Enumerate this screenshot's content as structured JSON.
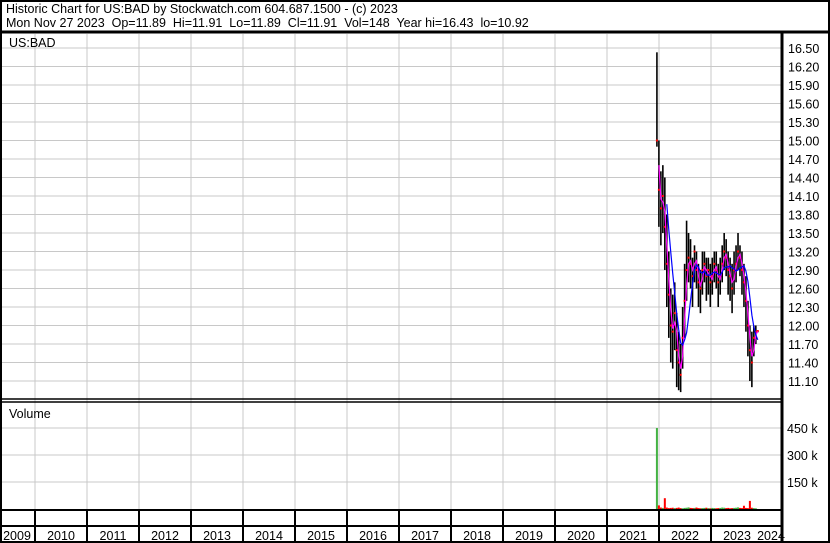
{
  "header": {
    "title_line": "Historic Chart for US:BAD by Stockwatch.com 604.687.1500 - (c) 2023",
    "quote_line": "Mon Nov 27 2023  Op=11.89  Hi=11.91  Lo=11.89  Cl=11.91  Vol=148  Year hi=16.43  lo=10.92"
  },
  "chart_data": {
    "type": "line",
    "title": "US:BAD",
    "volume_title": "Volume",
    "y_ticks": [
      "16.50",
      "16.20",
      "15.90",
      "15.60",
      "15.30",
      "15.00",
      "14.70",
      "14.40",
      "14.10",
      "13.80",
      "13.50",
      "13.20",
      "12.90",
      "12.60",
      "12.30",
      "12.00",
      "11.70",
      "11.40",
      "11.10"
    ],
    "ylim": [
      10.92,
      16.56
    ],
    "volume_ticks": [
      "450 k",
      "300 k",
      "150 k"
    ],
    "volume_ylim": [
      0,
      560
    ],
    "x_labels": [
      "2009",
      "2010",
      "2011",
      "2012",
      "2013",
      "2014",
      "2015",
      "2016",
      "2017",
      "2018",
      "2019",
      "2020",
      "2021",
      "2022",
      "2023",
      "2024"
    ],
    "xlim": [
      2009,
      2024.3
    ],
    "start": 2021.96,
    "end": 2023.9,
    "close": [
      15.0,
      14.2,
      13.9,
      14.1,
      13.6,
      13.0,
      12.5,
      12.0,
      11.9,
      12.2,
      11.6,
      11.4,
      11.2,
      11.8,
      12.4,
      12.9,
      13.1,
      13.0,
      12.8,
      13.2,
      12.9,
      12.7,
      12.6,
      12.9,
      13.0,
      12.8,
      12.9,
      12.7,
      12.8,
      13.0,
      12.9,
      12.7,
      12.8,
      13.0,
      13.2,
      13.1,
      12.9,
      12.8,
      12.6,
      12.9,
      13.0,
      13.2,
      13.1,
      12.9,
      12.7,
      12.4,
      12.0,
      11.6,
      11.4,
      11.8,
      11.9,
      11.91
    ],
    "high": [
      16.43,
      15.0,
      14.5,
      14.6,
      14.4,
      13.8,
      13.2,
      12.6,
      12.5,
      12.7,
      12.2,
      11.9,
      11.7,
      12.3,
      13.0,
      13.7,
      13.5,
      13.4,
      13.1,
      13.3,
      13.2,
      13.0,
      12.9,
      13.2,
      13.2,
      13.1,
      13.1,
      13.0,
      13.1,
      13.2,
      13.2,
      13.0,
      13.1,
      13.3,
      13.5,
      13.4,
      13.2,
      13.1,
      13.0,
      13.2,
      13.3,
      13.5,
      13.3,
      13.2,
      13.0,
      12.8,
      12.4,
      12.0,
      11.9,
      12.0,
      12.0,
      11.91
    ],
    "low": [
      14.9,
      13.6,
      13.3,
      13.5,
      12.9,
      12.3,
      11.8,
      11.4,
      11.3,
      11.6,
      11.0,
      10.95,
      10.92,
      11.3,
      11.8,
      12.4,
      12.7,
      12.6,
      12.3,
      12.7,
      12.6,
      12.3,
      12.2,
      12.5,
      12.7,
      12.4,
      12.5,
      12.3,
      12.5,
      12.7,
      12.6,
      12.3,
      12.5,
      12.7,
      12.9,
      12.8,
      12.5,
      12.4,
      12.2,
      12.5,
      12.7,
      12.9,
      12.8,
      12.5,
      12.3,
      11.9,
      11.5,
      11.1,
      11.0,
      11.5,
      11.7,
      11.89
    ],
    "volume_k": [
      450,
      20,
      8,
      6,
      60,
      8,
      5,
      6,
      7,
      5,
      6,
      8,
      5,
      4,
      6,
      7,
      9,
      6,
      5,
      6,
      8,
      5,
      4,
      5,
      6,
      7,
      5,
      4,
      6,
      5,
      4,
      5,
      6,
      8,
      7,
      5,
      6,
      4,
      5,
      6,
      7,
      9,
      6,
      5,
      18,
      6,
      5,
      45,
      7,
      5,
      4,
      0.148
    ],
    "ma_short_color": "#ff00ff",
    "ma_long_color": "#0000ff",
    "bar_color": "#000000",
    "close_dot_color": "#ff0000",
    "volume_up_color": "#44b244",
    "volume_down_color": "#ff0000",
    "grid": true
  }
}
